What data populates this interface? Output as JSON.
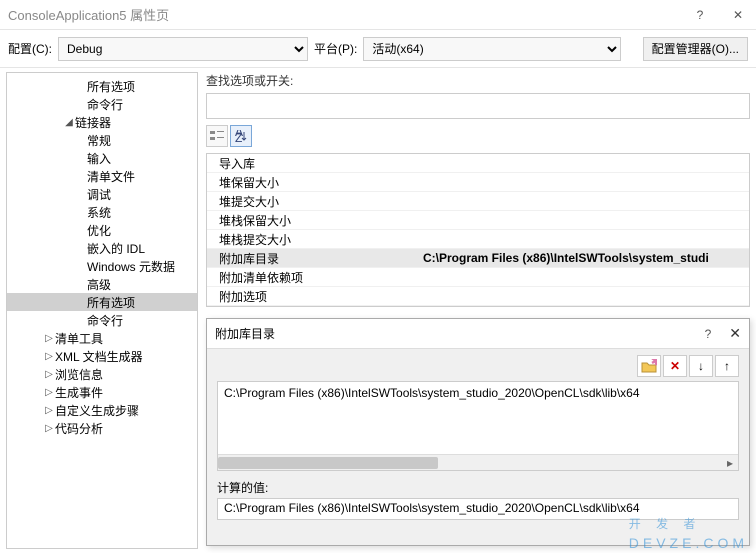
{
  "window": {
    "title": "ConsoleApplication5 属性页"
  },
  "config": {
    "label": "配置(C):",
    "value": "Debug",
    "platform_label": "平台(P):",
    "platform_value": "活动(x64)",
    "manager": "配置管理器(O)..."
  },
  "tree": [
    {
      "level": 3,
      "label": "所有选项"
    },
    {
      "level": 3,
      "label": "命令行"
    },
    {
      "level": 2,
      "label": "链接器",
      "tw": "◢"
    },
    {
      "level": 3,
      "label": "常规"
    },
    {
      "level": 3,
      "label": "输入"
    },
    {
      "level": 3,
      "label": "清单文件"
    },
    {
      "level": 3,
      "label": "调试"
    },
    {
      "level": 3,
      "label": "系统"
    },
    {
      "level": 3,
      "label": "优化"
    },
    {
      "level": 3,
      "label": "嵌入的 IDL"
    },
    {
      "level": 3,
      "label": "Windows 元数据"
    },
    {
      "level": 3,
      "label": "高级"
    },
    {
      "level": 3,
      "label": "所有选项",
      "selected": true
    },
    {
      "level": 3,
      "label": "命令行"
    },
    {
      "level": 1,
      "label": "清单工具",
      "tw": "▷"
    },
    {
      "level": 1,
      "label": "XML 文档生成器",
      "tw": "▷"
    },
    {
      "level": 1,
      "label": "浏览信息",
      "tw": "▷"
    },
    {
      "level": 1,
      "label": "生成事件",
      "tw": "▷"
    },
    {
      "level": 1,
      "label": "自定义生成步骤",
      "tw": "▷"
    },
    {
      "level": 1,
      "label": "代码分析",
      "tw": "▷"
    }
  ],
  "search": {
    "label": "查找选项或开关:",
    "value": ""
  },
  "props": [
    {
      "name": "导入库",
      "val": ""
    },
    {
      "name": "堆保留大小",
      "val": ""
    },
    {
      "name": "堆提交大小",
      "val": ""
    },
    {
      "name": "堆栈保留大小",
      "val": ""
    },
    {
      "name": "堆栈提交大小",
      "val": ""
    },
    {
      "name": "附加库目录",
      "val": "C:\\Program Files (x86)\\IntelSWTools\\system_studi",
      "selected": true
    },
    {
      "name": "附加清单依赖项",
      "val": ""
    },
    {
      "name": "附加选项",
      "val": ""
    }
  ],
  "dialog": {
    "title": "附加库目录",
    "path": "C:\\Program Files (x86)\\IntelSWTools\\system_studio_2020\\OpenCL\\sdk\\lib\\x64",
    "calc_label": "计算的值:",
    "calc_value": "C:\\Program Files (x86)\\IntelSWTools\\system_studio_2020\\OpenCL\\sdk\\lib\\x64"
  },
  "watermark": {
    "main": "开 发 者",
    "sub": "DEVZE.COM"
  }
}
